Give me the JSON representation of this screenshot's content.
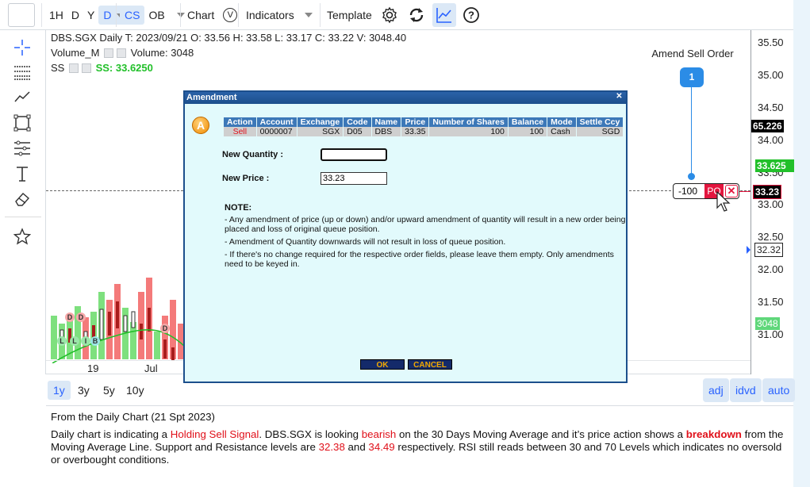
{
  "toolbar": {
    "intervals": [
      "1H",
      "D",
      "Y"
    ],
    "interval_selected": "D",
    "cs_label": "CS",
    "ob_label": "OB",
    "chart_label": "Chart",
    "chart_v_label": "V",
    "indicators_label": "Indicators",
    "template_label": "Template"
  },
  "legend": {
    "line1": "DBS.SGX Daily   T: 2023/09/21   O: 33.56   H: 33.58   L: 33.17   C: 33.22   V: 3048.40",
    "volume_label": "Volume_M",
    "volume_value": "Volume: 3048",
    "ss_label": "SS",
    "ss_value": "SS: 33.6250"
  },
  "x_axis": [
    "19",
    "Jul"
  ],
  "y_axis": [
    "35.50",
    "35.00",
    "34.50",
    "34.00",
    "33.50",
    "33.00",
    "32.50",
    "32.00",
    "31.50",
    "31.00"
  ],
  "price_tags": {
    "last": "65.226",
    "ss": "33.625",
    "order": "33.23",
    "cursor": "32.32",
    "volume": "3048"
  },
  "order_marker": {
    "callout_number": "1",
    "callout_label": "Amend Sell Order",
    "quantity": "-100",
    "type": "PO"
  },
  "bottom": {
    "ranges": [
      "1y",
      "3y",
      "5y",
      "10y"
    ],
    "range_selected": "1y",
    "right_buttons": [
      "adj",
      "idvd",
      "auto"
    ]
  },
  "commentary": {
    "heading": "From the Daily Chart (21 Spt 2023)",
    "p1": "Daily chart is indicating a ",
    "signal": "Holding Sell Signal",
    "p2": ". DBS.SGX is looking ",
    "bearish": "bearish",
    "p3": " on the 30 Days Moving Average and it’s price action shows a ",
    "breakdown": "breakdown",
    "p4": " from the Moving Average Line. Support and Resistance levels are ",
    "support": "32.38",
    "and": " and ",
    "resistance": "34.49",
    "p5": " respectively. RSI still reads between 30 and 70 Levels which indicates no oversold or overbought conditions."
  },
  "dialog": {
    "title": "Amendment",
    "icon_letter": "A",
    "columns": [
      "Action",
      "Account",
      "Exchange",
      "Code",
      "Name",
      "Price",
      "Number of Shares",
      "Balance",
      "Mode",
      "Settle Ccy"
    ],
    "row": [
      "Sell",
      "0000007",
      "SGX",
      "D05",
      "DBS",
      "33.35",
      "100",
      "100",
      "Cash",
      "SGD"
    ],
    "new_quantity_label": "New Quantity :",
    "new_quantity_value": "",
    "new_price_label": "New Price :",
    "new_price_value": "33.23",
    "note_title": "NOTE:",
    "notes": [
      " - Any amendment of price (up or down) and/or upward amendment of quantity will result in a new order being placed and loss of original queue position.",
      " - Amendment of Quantity downwards will not result in loss of queue position.",
      " - If there's no change required for the respective order fields, please leave them empty. Only amendments need to be keyed in."
    ],
    "ok_label": "OK",
    "cancel_label": "CANCEL"
  },
  "colors": {
    "accent": "#2962ff",
    "sell": "#e0101a",
    "dialog_header": "#1c4f8c",
    "table_header": "#3c78b8",
    "ss_green": "#22c02a",
    "order_red": "#e3163f"
  }
}
